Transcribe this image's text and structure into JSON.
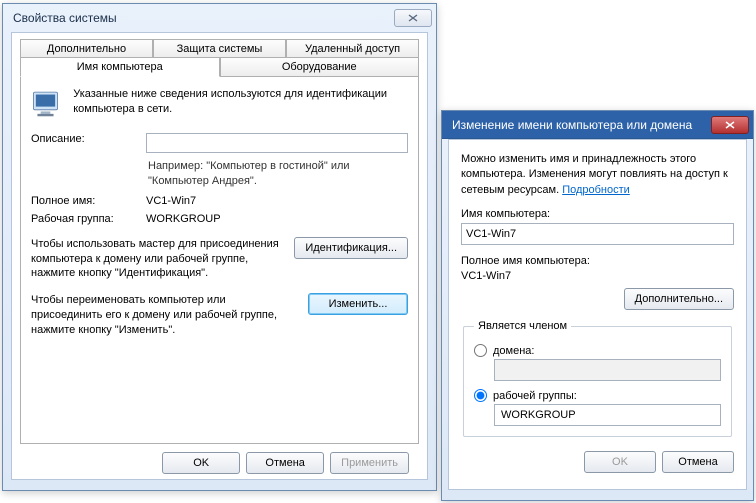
{
  "win1": {
    "title": "Свойства системы",
    "tabs": {
      "row1": [
        "Дополнительно",
        "Защита системы",
        "Удаленный доступ"
      ],
      "row2": [
        "Имя компьютера",
        "Оборудование"
      ],
      "active": "Имя компьютера"
    },
    "intro": "Указанные ниже сведения используются для идентификации компьютера в сети.",
    "fields": {
      "description_label": "Описание:",
      "description_value": "",
      "example_hint": "Например: \"Компьютер в гостиной\" или \"Компьютер Андрея\".",
      "fullname_label": "Полное имя:",
      "fullname_value": "VC1-Win7",
      "workgroup_label": "Рабочая группа:",
      "workgroup_value": "WORKGROUP"
    },
    "identify_text": "Чтобы использовать мастер для присоединения компьютера к домену или рабочей группе, нажмите кнопку \"Идентификация\".",
    "identify_btn": "Идентификация...",
    "change_text": "Чтобы переименовать компьютер или присоединить его к домену или рабочей группе, нажмите кнопку \"Изменить\".",
    "change_btn": "Изменить...",
    "footer": {
      "ok": "OK",
      "cancel": "Отмена",
      "apply": "Применить"
    }
  },
  "win2": {
    "title": "Изменение имени компьютера или домена",
    "intro_a": "Можно изменить имя и принадлежность этого компьютера. Изменения могут повлиять на доступ к сетевым ресурсам. ",
    "intro_link": "Подробности",
    "name_label": "Имя компьютера:",
    "name_value": "VC1-Win7",
    "fullname_label": "Полное имя компьютера:",
    "fullname_value": "VC1-Win7",
    "more_btn": "Дополнительно...",
    "memberof_legend": "Является членом",
    "domain_label": "домена:",
    "domain_value": "",
    "workgroup_label": "рабочей группы:",
    "workgroup_value": "WORKGROUP",
    "footer": {
      "ok": "OK",
      "cancel": "Отмена"
    }
  }
}
